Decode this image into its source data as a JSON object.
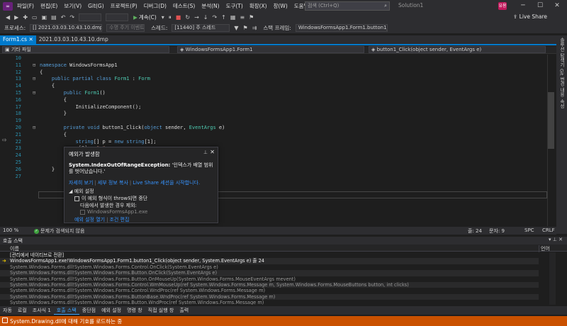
{
  "menu": {
    "items": [
      "파일(F)",
      "편집(E)",
      "보기(V)",
      "Git(G)",
      "프로젝트(P)",
      "디버그(D)",
      "테스트(S)",
      "분석(N)",
      "도구(T)",
      "확장(X)",
      "창(W)",
      "도움말(H)"
    ],
    "search_placeholder": "검색 (Ctrl+Q)",
    "solution_name": "Solution1",
    "avatar_initials": "유용",
    "live_share": "Live Share"
  },
  "toolbar": {
    "continue_label": "계속(C)"
  },
  "debug_location": {
    "process_label": "프로세스:",
    "process_value": "[] 2021.03.03.10.43.10.dmp",
    "lifecycle_label": "수명 주기 이벤트",
    "thread_label": "스레드:",
    "thread_value": "[11440] 주 스레드",
    "stack_label": "스택 프레임:",
    "stack_value": "WindowsFormsApp1.Form1.button1_Clic"
  },
  "tabs": [
    {
      "label": "Form1.cs",
      "active": true
    },
    {
      "label": "2021.03.03.10.43.10.dmp",
      "active": false
    }
  ],
  "navbar": {
    "project": "기타 파일",
    "type": "WindowsFormsApp1.Form1",
    "member": "button1_Click(object sender, EventArgs e)"
  },
  "side_panels": [
    "솔루션 탐색기",
    "Git 변경 내용",
    "속성"
  ],
  "code_lines": [
    {
      "n": "10",
      "fold": "",
      "html": ""
    },
    {
      "n": "11",
      "fold": "⊟",
      "html": "<span class=\"kw\">namespace</span> WindowsFormsApp1"
    },
    {
      "n": "12",
      "fold": "",
      "html": "{"
    },
    {
      "n": "13",
      "fold": "⊟",
      "html": "    <span class=\"kw\">public partial class</span> <span class=\"ty\">Form1</span> : <span class=\"ty\">Form</span>"
    },
    {
      "n": "14",
      "fold": "",
      "html": "    {"
    },
    {
      "n": "15",
      "fold": "⊟",
      "html": "        <span class=\"kw\">public</span> <span class=\"ty\">Form1</span>()"
    },
    {
      "n": "16",
      "fold": "",
      "html": "        {"
    },
    {
      "n": "17",
      "fold": "",
      "html": "            InitializeComponent();"
    },
    {
      "n": "18",
      "fold": "",
      "html": "        }"
    },
    {
      "n": "19",
      "fold": "",
      "html": ""
    },
    {
      "n": "20",
      "fold": "⊟",
      "html": "        <span class=\"kw\">private void</span> button1_Click(<span class=\"kw\">object</span> sender, <span class=\"ty\">EventArgs</span> e)"
    },
    {
      "n": "21",
      "fold": "",
      "html": "        {"
    },
    {
      "n": "22",
      "fold": "",
      "html": "            <span class=\"kw\">string</span>[] p = <span class=\"kw\">new string</span>[1];"
    },
    {
      "n": "23",
      "fold": "",
      "html": "            p[2] = <span class=\"str\">\"a\"</span>;"
    },
    {
      "n": "24",
      "fold": "",
      "html": ""
    },
    {
      "n": "25",
      "fold": "",
      "html": "        }"
    },
    {
      "n": "26",
      "fold": "",
      "html": "    }"
    },
    {
      "n": "27",
      "fold": "",
      "html": ""
    }
  ],
  "exception": {
    "title": "예외가 발생함",
    "type": "System.IndexOutOfRangeException:",
    "message": " '인덱스가 배열 범위를 벗어났습니다.'",
    "links": [
      "자세히 보기",
      "세부 정보 복사",
      "Live Share 세션을 시작합니다."
    ],
    "settings_header": "◢ 예외 설정",
    "break_when_thrown": "이 예외 형식이 throw되면 중단",
    "except_when": "다음에서 발생한 경우 제외:",
    "module": "WindowsFormsApp1.exe",
    "bottom_links": [
      "예외 설정 열기",
      "조건 편집"
    ]
  },
  "editor_status": {
    "zoom": "100 %",
    "issues": "문제가 검색되지 않음",
    "line": "줄: 24",
    "char": "문자: 9",
    "mode": "SPC",
    "eol": "CRLF"
  },
  "call_stack": {
    "title": "호출 스택",
    "col_name": "이름",
    "col_lang": "언어",
    "rows": [
      {
        "name": "[관리에서 네이티브로 전환]",
        "lang": "",
        "kind": "cur"
      },
      {
        "name": "WindowsFormsApp1.exe!WindowsFormsApp1.Form1.button1_Click(object sender, System.EventArgs e) 줄 24",
        "lang": "C#",
        "kind": "cur",
        "current": true
      },
      {
        "name": "System.Windows.Forms.dll!System.Windows.Forms.Control.OnClick(System.EventArgs e)",
        "lang": "알...",
        "kind": "ext"
      },
      {
        "name": "System.Windows.Forms.dll!System.Windows.Forms.Button.OnClick(System.EventArgs e)",
        "lang": "알...",
        "kind": "ext"
      },
      {
        "name": "System.Windows.Forms.dll!System.Windows.Forms.Button.OnMouseUp(System.Windows.Forms.MouseEventArgs mevent)",
        "lang": "알...",
        "kind": "ext"
      },
      {
        "name": "System.Windows.Forms.dll!System.Windows.Forms.Control.WmMouseUp(ref System.Windows.Forms.Message m, System.Windows.Forms.MouseButtons button, int clicks)",
        "lang": "알...",
        "kind": "ext"
      },
      {
        "name": "System.Windows.Forms.dll!System.Windows.Forms.Control.WndProc(ref System.Windows.Forms.Message m)",
        "lang": "알...",
        "kind": "ext"
      },
      {
        "name": "System.Windows.Forms.dll!System.Windows.Forms.ButtonBase.WndProc(ref System.Windows.Forms.Message m)",
        "lang": "알...",
        "kind": "ext"
      },
      {
        "name": "System.Windows.Forms.dll!System.Windows.Forms.Button.WndProc(ref System.Windows.Forms.Message m)",
        "lang": "알...",
        "kind": "ext"
      }
    ]
  },
  "bottom_tabs": [
    {
      "label": "자동",
      "active": false
    },
    {
      "label": "로컬",
      "active": false
    },
    {
      "label": "조사식 1",
      "active": false
    },
    {
      "label": "호출 스택",
      "active": true
    },
    {
      "label": "중단점",
      "active": false
    },
    {
      "label": "예외 설정",
      "active": false
    },
    {
      "label": "명령 창",
      "active": false
    },
    {
      "label": "직접 실행 창",
      "active": false
    },
    {
      "label": "출력",
      "active": false
    }
  ],
  "status_bar": {
    "message": "System.Drawing.dll에 대해 기호를 로드하는 중"
  },
  "colors": {
    "accent": "#007acc",
    "status_bar": "#ca5100",
    "error": "#e51400"
  }
}
